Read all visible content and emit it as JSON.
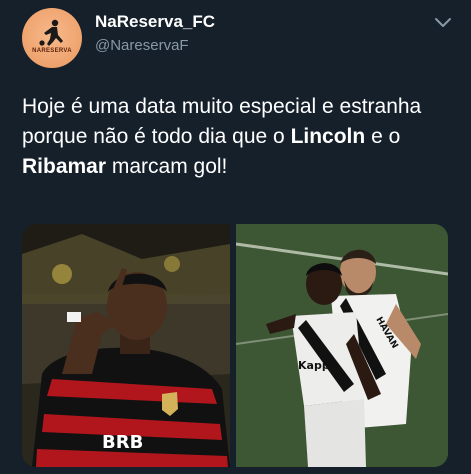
{
  "account": {
    "display_name": "NaReserva_FC",
    "handle": "@NareservaF",
    "avatar_brand": "NARESERVA"
  },
  "tweet": {
    "text_part1": "Hoje é uma data muito especial e estranha porque não é todo dia que o ",
    "highlight1": "Lincoln",
    "text_part2": " e o ",
    "highlight2": "Ribamar",
    "text_part3": " marcam gol!"
  },
  "media": {
    "left_photo": {
      "jersey_sponsor": "BRB"
    },
    "right_photo": {
      "jersey_text": "HAVAN",
      "jersey_sponsor": "Kappa"
    }
  },
  "colors": {
    "background": "#15202b",
    "secondary_text": "#8899a6",
    "avatar": "#f0a672"
  }
}
